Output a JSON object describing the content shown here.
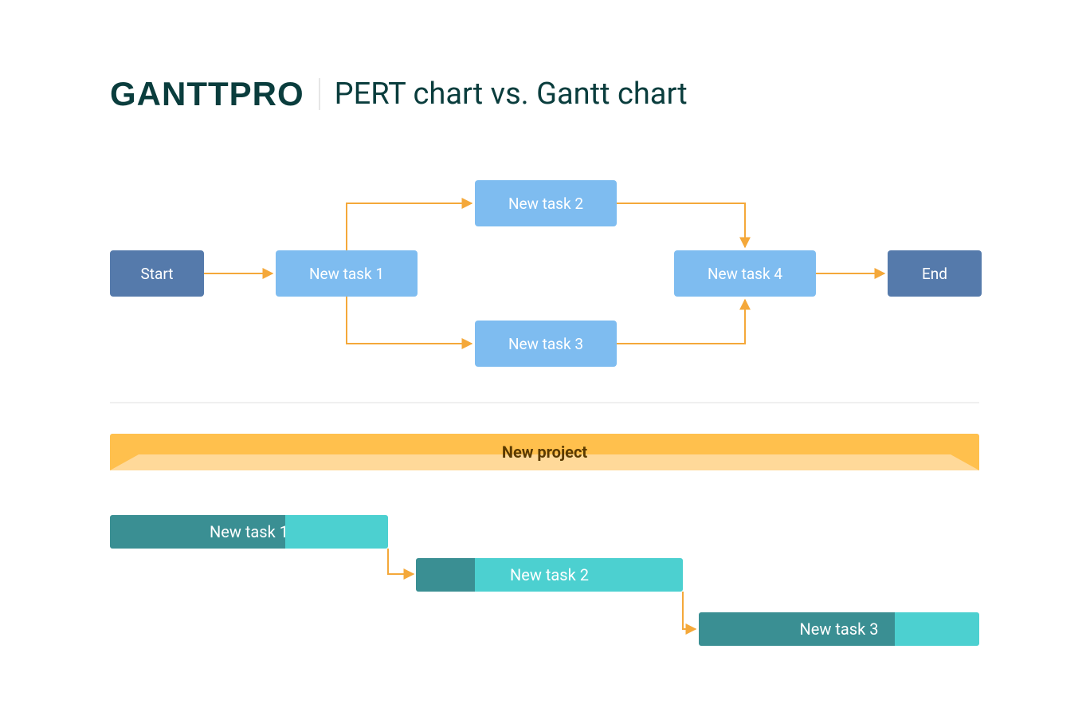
{
  "header": {
    "logo_text": "GANTTPRO",
    "title": "PERT chart vs. Gantt chart"
  },
  "pert": {
    "nodes": {
      "start": "Start",
      "t1": "New task 1",
      "t2": "New task 2",
      "t3": "New task 3",
      "t4": "New task 4",
      "end": "End"
    }
  },
  "gantt": {
    "project_label": "New project",
    "bars": {
      "b1": "New task 1",
      "b2": "New task 2",
      "b3": "New task 3"
    }
  },
  "colors": {
    "dark_teal": "#0a3d3d",
    "node_dark": "#557aab",
    "node_light": "#7ebcf0",
    "arrow": "#f4a83a",
    "proj_main": "#ffc04d",
    "proj_light": "#ffd999",
    "gantt_dark": "#3a8f93",
    "gantt_light": "#4cd0d0"
  }
}
